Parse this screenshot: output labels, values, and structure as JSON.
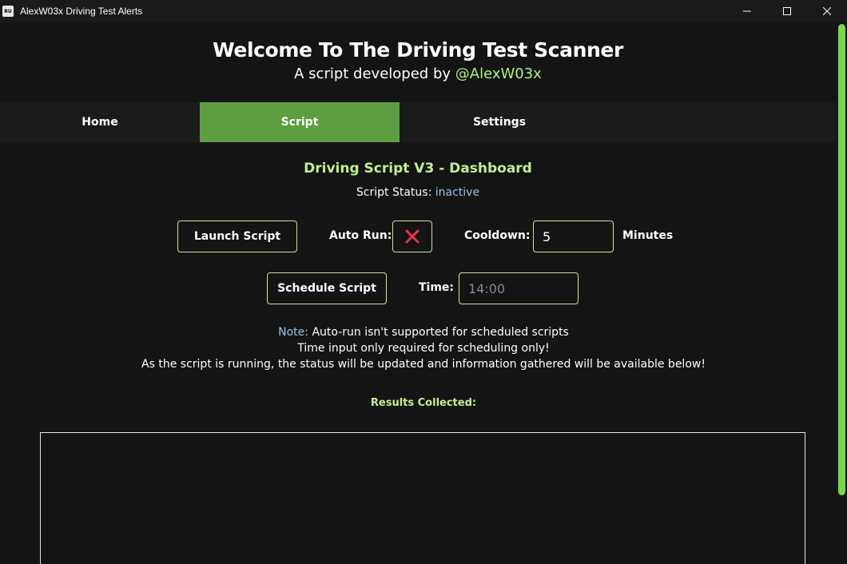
{
  "window": {
    "icon_text": "RU",
    "title": "AlexW03x Driving Test Alerts"
  },
  "header": {
    "title": "Welcome To The Driving Test Scanner",
    "subtitle_prefix": "A script developed by ",
    "subtitle_handle": "@AlexW03x"
  },
  "nav": {
    "tabs": [
      {
        "label": "Home",
        "active": false
      },
      {
        "label": "Script",
        "active": true
      },
      {
        "label": "Settings",
        "active": false
      }
    ]
  },
  "dashboard": {
    "title": "Driving Script V3 - Dashboard",
    "status_label": "Script Status: ",
    "status_value": "inactive",
    "launch_button": "Launch Script",
    "auto_run_label": "Auto Run:",
    "auto_run_enabled": false,
    "cooldown_label": "Cooldown:",
    "cooldown_value": "5",
    "cooldown_unit": "Minutes",
    "schedule_button": "Schedule Script",
    "time_label": "Time:",
    "time_placeholder": "14:00"
  },
  "notes": {
    "note_key": "Note:",
    "line1": " Auto-run isn't supported for scheduled scripts",
    "line2": "Time input only required for scheduling only!",
    "line3": "As the script is running, the status will be updated and information gathered will be available below!"
  },
  "results": {
    "title": "Results Collected:"
  },
  "colors": {
    "accent_green": "#5e9e40",
    "title_green": "#c4ee8e",
    "status_blue": "#93c3f2",
    "cross_red": "#e8334f",
    "scrollbar_green": "#79d847"
  }
}
